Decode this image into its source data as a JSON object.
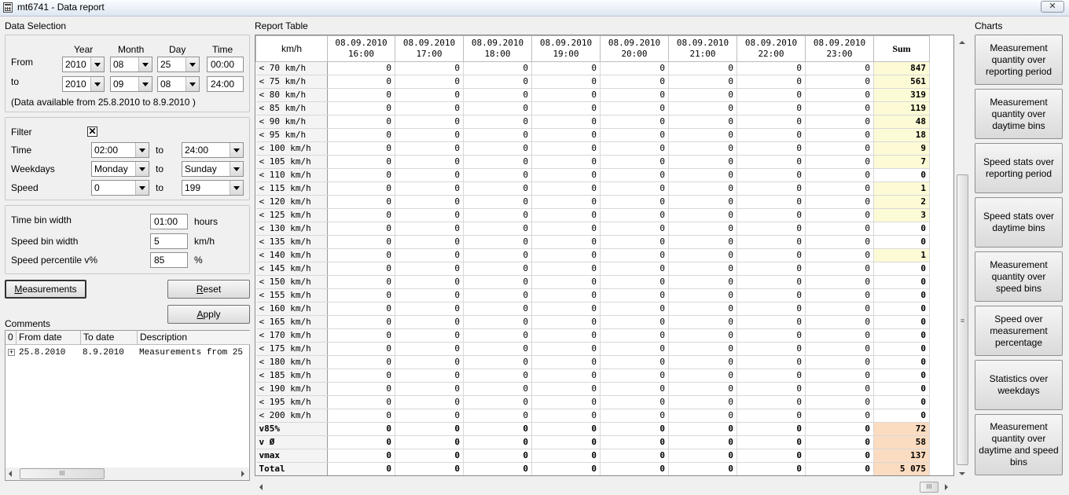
{
  "window": {
    "title": "mt6741 - Data report",
    "close_label": "✕"
  },
  "data_selection": {
    "heading": "Data Selection",
    "col_year": "Year",
    "col_month": "Month",
    "col_day": "Day",
    "col_time": "Time",
    "from_label": "From",
    "to_label": "to",
    "from": {
      "year": "2010",
      "month": "08",
      "day": "25",
      "time": "00:00"
    },
    "to": {
      "year": "2010",
      "month": "09",
      "day": "08",
      "time": "24:00"
    },
    "availability": "(Data available from 25.8.2010  to 8.9.2010 )"
  },
  "filter": {
    "filter_label": "Filter",
    "checked_mark": "✕",
    "time_label": "Time",
    "time_from": "02:00",
    "time_to": "24:00",
    "weekdays_label": "Weekdays",
    "weekday_from": "Monday",
    "weekday_to": "Sunday",
    "speed_label": "Speed",
    "speed_from": "0",
    "speed_to": "199",
    "to_word": "to"
  },
  "bins": {
    "time_bin_label": "Time bin width",
    "time_bin_value": "01:00",
    "time_bin_unit": "hours",
    "speed_bin_label": "Speed bin width",
    "speed_bin_value": "5",
    "speed_bin_unit": "km/h",
    "percentile_label": "Speed percentile v%",
    "percentile_value": "85",
    "percentile_unit": "%"
  },
  "buttons": {
    "measurements_u": "M",
    "measurements_rest": "easurements",
    "reset_u": "R",
    "reset_rest": "eset",
    "apply_u": "A",
    "apply_rest": "pply"
  },
  "comments": {
    "heading": "Comments",
    "col0": "0",
    "col_from": "From date",
    "col_to": "To date",
    "col_desc": "Description",
    "row_expand": "+",
    "row": {
      "from": "25.8.2010",
      "to": "8.9.2010",
      "desc": "Measurements from 25"
    }
  },
  "report": {
    "heading": "Report Table",
    "corner": "km/h",
    "columns": [
      {
        "date": "08.09.2010",
        "time": "16:00"
      },
      {
        "date": "08.09.2010",
        "time": "17:00"
      },
      {
        "date": "08.09.2010",
        "time": "18:00"
      },
      {
        "date": "08.09.2010",
        "time": "19:00"
      },
      {
        "date": "08.09.2010",
        "time": "20:00"
      },
      {
        "date": "08.09.2010",
        "time": "21:00"
      },
      {
        "date": "08.09.2010",
        "time": "22:00"
      },
      {
        "date": "08.09.2010",
        "time": "23:00"
      }
    ],
    "sum_header": "Sum",
    "rows": [
      {
        "label": "< 70  km/h",
        "values": [
          "0",
          "0",
          "0",
          "0",
          "0",
          "0",
          "0",
          "0"
        ],
        "sum": "847",
        "hl": "yellow"
      },
      {
        "label": "< 75  km/h",
        "values": [
          "0",
          "0",
          "0",
          "0",
          "0",
          "0",
          "0",
          "0"
        ],
        "sum": "561",
        "hl": "yellow"
      },
      {
        "label": "< 80  km/h",
        "values": [
          "0",
          "0",
          "0",
          "0",
          "0",
          "0",
          "0",
          "0"
        ],
        "sum": "319",
        "hl": "yellow"
      },
      {
        "label": "< 85  km/h",
        "values": [
          "0",
          "0",
          "0",
          "0",
          "0",
          "0",
          "0",
          "0"
        ],
        "sum": "119",
        "hl": "yellow"
      },
      {
        "label": "< 90  km/h",
        "values": [
          "0",
          "0",
          "0",
          "0",
          "0",
          "0",
          "0",
          "0"
        ],
        "sum": "48",
        "hl": "yellow"
      },
      {
        "label": "< 95  km/h",
        "values": [
          "0",
          "0",
          "0",
          "0",
          "0",
          "0",
          "0",
          "0"
        ],
        "sum": "18",
        "hl": "yellow"
      },
      {
        "label": "< 100  km/h",
        "values": [
          "0",
          "0",
          "0",
          "0",
          "0",
          "0",
          "0",
          "0"
        ],
        "sum": "9",
        "hl": "yellow"
      },
      {
        "label": "< 105  km/h",
        "values": [
          "0",
          "0",
          "0",
          "0",
          "0",
          "0",
          "0",
          "0"
        ],
        "sum": "7",
        "hl": "yellow"
      },
      {
        "label": "< 110  km/h",
        "values": [
          "0",
          "0",
          "0",
          "0",
          "0",
          "0",
          "0",
          "0"
        ],
        "sum": "0",
        "hl": ""
      },
      {
        "label": "< 115  km/h",
        "values": [
          "0",
          "0",
          "0",
          "0",
          "0",
          "0",
          "0",
          "0"
        ],
        "sum": "1",
        "hl": "yellow"
      },
      {
        "label": "< 120  km/h",
        "values": [
          "0",
          "0",
          "0",
          "0",
          "0",
          "0",
          "0",
          "0"
        ],
        "sum": "2",
        "hl": "yellow"
      },
      {
        "label": "< 125  km/h",
        "values": [
          "0",
          "0",
          "0",
          "0",
          "0",
          "0",
          "0",
          "0"
        ],
        "sum": "3",
        "hl": "yellow"
      },
      {
        "label": "< 130  km/h",
        "values": [
          "0",
          "0",
          "0",
          "0",
          "0",
          "0",
          "0",
          "0"
        ],
        "sum": "0",
        "hl": ""
      },
      {
        "label": "< 135  km/h",
        "values": [
          "0",
          "0",
          "0",
          "0",
          "0",
          "0",
          "0",
          "0"
        ],
        "sum": "0",
        "hl": ""
      },
      {
        "label": "< 140  km/h",
        "values": [
          "0",
          "0",
          "0",
          "0",
          "0",
          "0",
          "0",
          "0"
        ],
        "sum": "1",
        "hl": "yellow"
      },
      {
        "label": "< 145  km/h",
        "values": [
          "0",
          "0",
          "0",
          "0",
          "0",
          "0",
          "0",
          "0"
        ],
        "sum": "0",
        "hl": ""
      },
      {
        "label": "< 150  km/h",
        "values": [
          "0",
          "0",
          "0",
          "0",
          "0",
          "0",
          "0",
          "0"
        ],
        "sum": "0",
        "hl": ""
      },
      {
        "label": "< 155  km/h",
        "values": [
          "0",
          "0",
          "0",
          "0",
          "0",
          "0",
          "0",
          "0"
        ],
        "sum": "0",
        "hl": ""
      },
      {
        "label": "< 160  km/h",
        "values": [
          "0",
          "0",
          "0",
          "0",
          "0",
          "0",
          "0",
          "0"
        ],
        "sum": "0",
        "hl": ""
      },
      {
        "label": "< 165  km/h",
        "values": [
          "0",
          "0",
          "0",
          "0",
          "0",
          "0",
          "0",
          "0"
        ],
        "sum": "0",
        "hl": ""
      },
      {
        "label": "< 170  km/h",
        "values": [
          "0",
          "0",
          "0",
          "0",
          "0",
          "0",
          "0",
          "0"
        ],
        "sum": "0",
        "hl": ""
      },
      {
        "label": "< 175  km/h",
        "values": [
          "0",
          "0",
          "0",
          "0",
          "0",
          "0",
          "0",
          "0"
        ],
        "sum": "0",
        "hl": ""
      },
      {
        "label": "< 180  km/h",
        "values": [
          "0",
          "0",
          "0",
          "0",
          "0",
          "0",
          "0",
          "0"
        ],
        "sum": "0",
        "hl": ""
      },
      {
        "label": "< 185  km/h",
        "values": [
          "0",
          "0",
          "0",
          "0",
          "0",
          "0",
          "0",
          "0"
        ],
        "sum": "0",
        "hl": ""
      },
      {
        "label": "< 190  km/h",
        "values": [
          "0",
          "0",
          "0",
          "0",
          "0",
          "0",
          "0",
          "0"
        ],
        "sum": "0",
        "hl": ""
      },
      {
        "label": "< 195  km/h",
        "values": [
          "0",
          "0",
          "0",
          "0",
          "0",
          "0",
          "0",
          "0"
        ],
        "sum": "0",
        "hl": ""
      },
      {
        "label": "< 200  km/h",
        "values": [
          "0",
          "0",
          "0",
          "0",
          "0",
          "0",
          "0",
          "0"
        ],
        "sum": "0",
        "hl": ""
      }
    ],
    "stat_rows": [
      {
        "label": "v85%",
        "values": [
          "0",
          "0",
          "0",
          "0",
          "0",
          "0",
          "0",
          "0"
        ],
        "sum": "72"
      },
      {
        "label": "v Ø",
        "values": [
          "0",
          "0",
          "0",
          "0",
          "0",
          "0",
          "0",
          "0"
        ],
        "sum": "58"
      },
      {
        "label": "vmax",
        "values": [
          "0",
          "0",
          "0",
          "0",
          "0",
          "0",
          "0",
          "0"
        ],
        "sum": "137"
      },
      {
        "label": "Total",
        "values": [
          "0",
          "0",
          "0",
          "0",
          "0",
          "0",
          "0",
          "0"
        ],
        "sum": "5 075"
      }
    ],
    "highlight_colors": {
      "yellow": "#fdfbd6",
      "orange": "#fbdcc0"
    }
  },
  "charts": {
    "heading": "Charts",
    "buttons": [
      "Measurement quantity over reporting period",
      "Measurement quantity over daytime bins",
      "Speed stats over reporting period",
      "Speed stats over daytime bins",
      "Measurement quantity over speed bins",
      "Speed over measurement percentage",
      "Statistics over weekdays",
      "Measurement quantity over daytime and speed bins"
    ]
  },
  "scrollbar": {
    "grip": "≡",
    "hgrip": "III"
  }
}
